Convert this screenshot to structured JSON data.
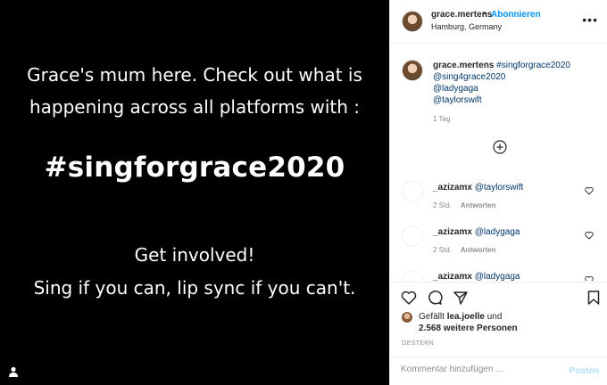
{
  "media": {
    "line1": "Grace's mum here. Check out what is",
    "line2": "happening across all platforms with :",
    "hashtag": "#singforgrace2020",
    "line3": "Get involved!",
    "line4": "Sing if you can, lip sync if you can't.",
    "tag_icon": "user-tag-icon"
  },
  "header": {
    "username": "grace.mertens",
    "separator": "•",
    "follow_label": "Abonnieren",
    "location": "Hamburg, Germany",
    "more_icon": "more-options-icon"
  },
  "caption": {
    "username": "grace.mertens",
    "hashtag": "#singforgrace2020",
    "tag1": "@sing4grace2020",
    "tag2": "@ladygaga",
    "tag3": "@taylorswift",
    "time": "1 Tag"
  },
  "load_more_icon": "plus-circle-icon",
  "comments": [
    {
      "user": "_azizamx",
      "mention": "@taylorswift",
      "time": "2 Std.",
      "reply": "Antworten"
    },
    {
      "user": "_azizamx",
      "mention": "@ladygaga",
      "time": "2 Std.",
      "reply": "Antworten"
    },
    {
      "user": "_azizamx",
      "mention": "@ladygaga",
      "time": "",
      "reply": ""
    }
  ],
  "likes": {
    "prefix": "Gefällt",
    "user": "lea.joelle",
    "and": "und",
    "others": "2.568 weitere Personen"
  },
  "date": "GESTERN",
  "add_comment": {
    "placeholder": "Kommentar hinzufügen ...",
    "post_label": "Posten"
  }
}
